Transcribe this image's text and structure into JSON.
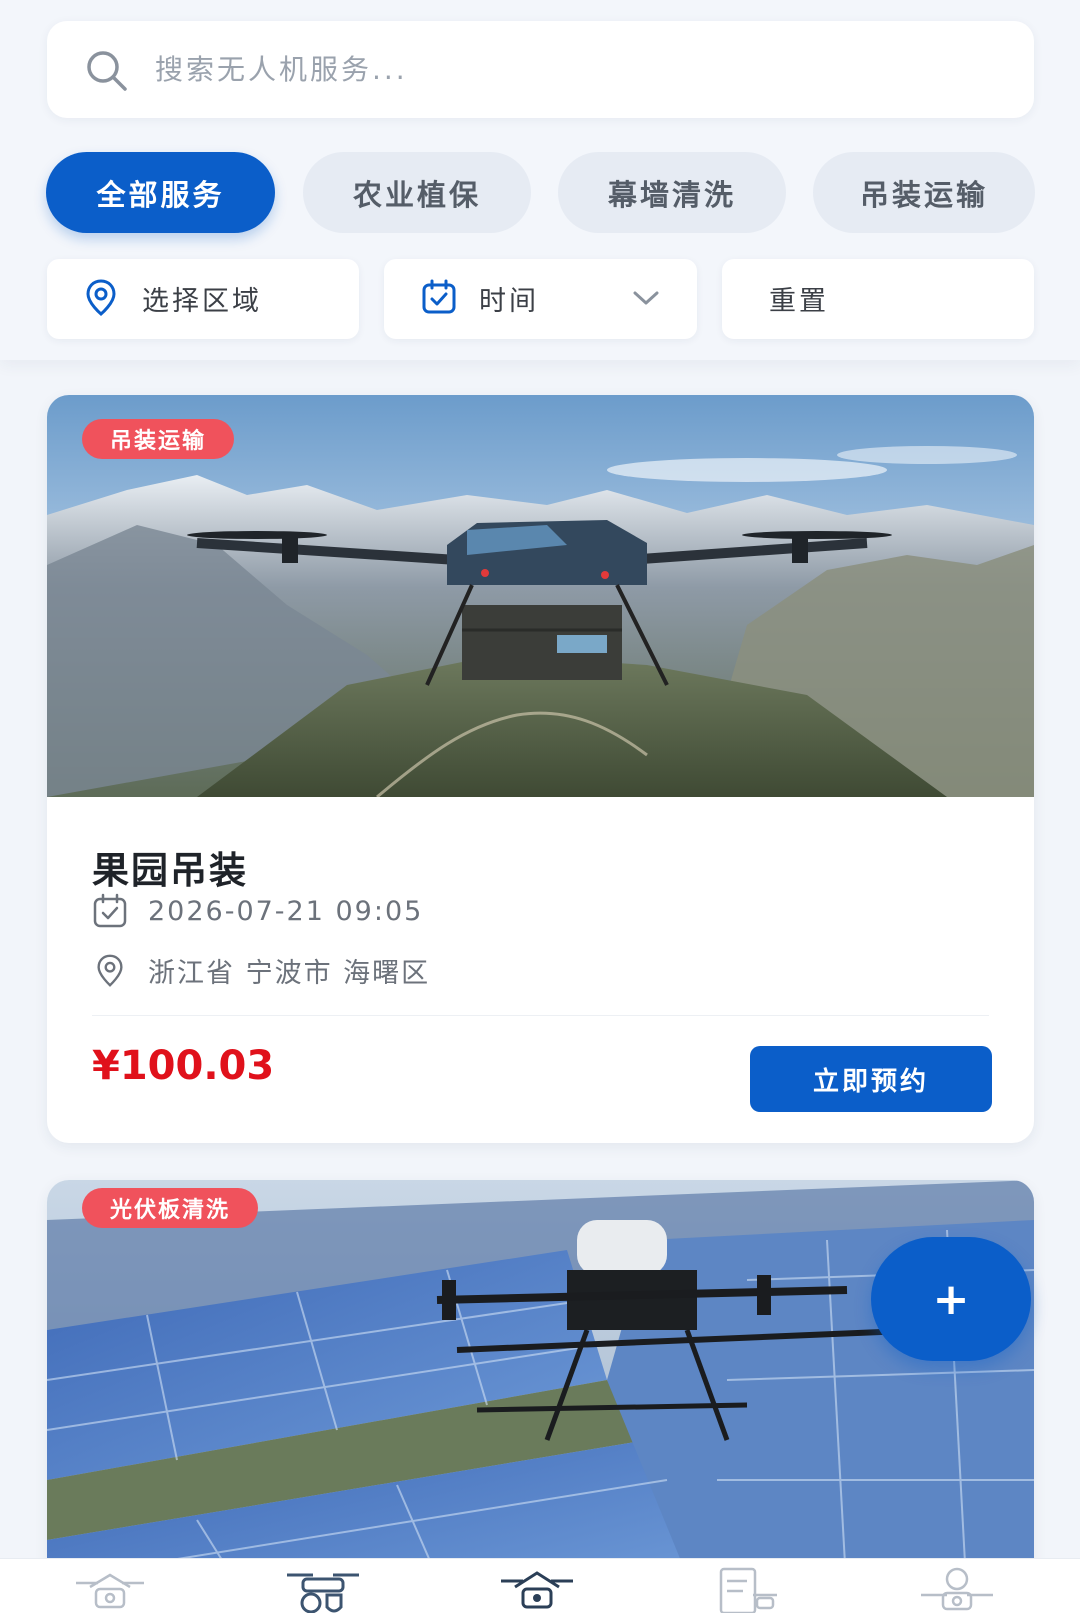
{
  "search": {
    "placeholder": "搜索无人机服务..."
  },
  "tabs": [
    {
      "label": "全部服务",
      "active": true
    },
    {
      "label": "农业植保",
      "active": false
    },
    {
      "label": "幕墙清洗",
      "active": false
    },
    {
      "label": "吊装运输",
      "active": false
    }
  ],
  "filters": {
    "region_label": "选择区域",
    "time_label": "时间",
    "reset_label": "重置"
  },
  "cards": [
    {
      "tag": "吊装运输",
      "title": "果园吊装",
      "datetime": "2026-07-21 09:05",
      "location": "浙江省 宁波市 海曙区",
      "price": "¥100.03",
      "button": "立即预约",
      "image": "mountain-drone-cargo-photo"
    },
    {
      "tag": "光伏板清洗",
      "image": "solar-panel-drone-photo"
    }
  ],
  "fab": {
    "label": "+"
  },
  "bottom_nav": {
    "items": [
      "home-drone-icon",
      "services-drone-icon",
      "center-drone-icon",
      "orders-drone-icon",
      "profile-drone-icon"
    ]
  },
  "colors": {
    "primary": "#0b5ec9",
    "price_red": "#e0111b",
    "tag_red": "#f0525c",
    "background": "#f2f5fa"
  }
}
